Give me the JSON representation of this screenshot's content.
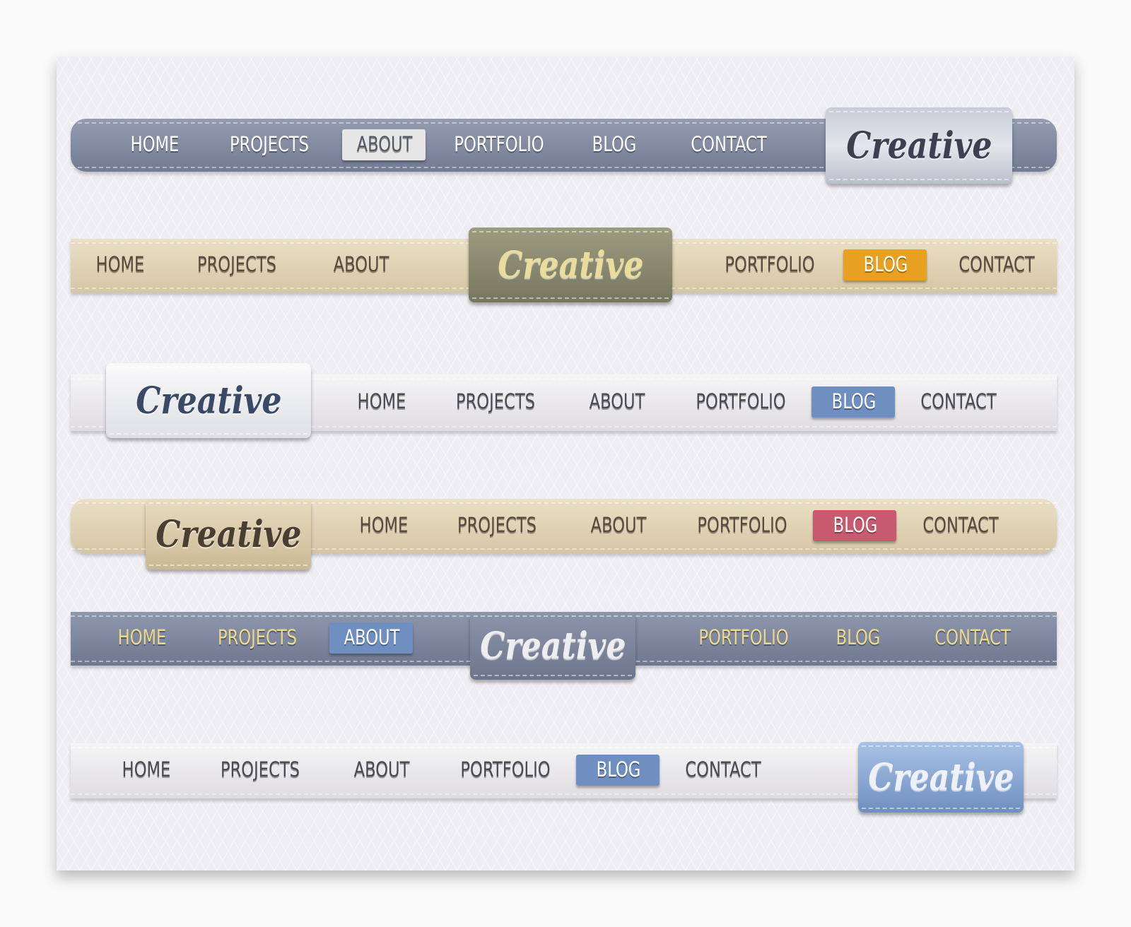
{
  "nav_items": [
    "HOME",
    "PROJECTS",
    "ABOUT",
    "PORTFOLIO",
    "BLOG",
    "CONTACT"
  ],
  "logo_text": "Creative",
  "bars": [
    {
      "style": "slate",
      "active": "ABOUT",
      "active_color": "#e6e6e6"
    },
    {
      "style": "tan",
      "active": "BLOG",
      "active_color": "#e8a020"
    },
    {
      "style": "light",
      "active": "BLOG",
      "active_color": "#6f8fc0"
    },
    {
      "style": "tan",
      "active": "BLOG",
      "active_color": "#c85a70"
    },
    {
      "style": "slate",
      "active": "ABOUT",
      "active_color": "#6f8fc0"
    },
    {
      "style": "light",
      "active": "BLOG",
      "active_color": "#6f8fc0"
    }
  ],
  "colors": {
    "slate": "#7f889e",
    "tan": "#ddcfb2",
    "light": "#ecebec",
    "logo_olive": "#8b8a6c",
    "logo_blue": "#8aa6d0"
  }
}
